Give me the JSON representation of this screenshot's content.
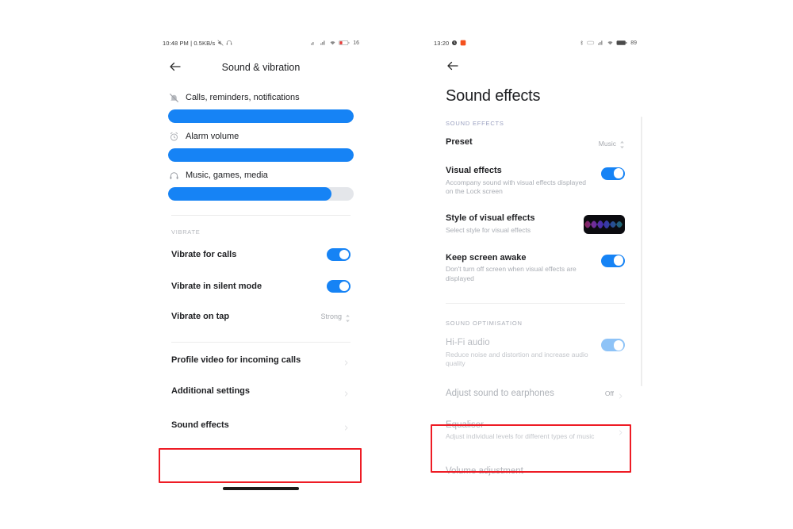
{
  "left_phone": {
    "status_bar": {
      "time": "10:48 PM | 0.5KB/s",
      "icons_left": [
        "mute-icon",
        "headphone-icon"
      ],
      "icons_right": [
        "signal-1-icon",
        "signal-2-icon",
        "wifi-icon",
        "battery-low-icon"
      ],
      "battery": "16"
    },
    "appbar": {
      "back": "back-arrow-icon",
      "title": "Sound & vibration"
    },
    "sliders": [
      {
        "icon": "ringer-muted-icon",
        "label": "Calls, reminders, notifications",
        "value": 100
      },
      {
        "icon": "alarm-clock-icon",
        "label": "Alarm volume",
        "value": 100
      },
      {
        "icon": "headphone-icon",
        "label": "Music, games, media",
        "value": 88
      }
    ],
    "vibrate_section": {
      "caption": "VIBRATE",
      "rows": [
        {
          "label": "Vibrate for calls",
          "control": "toggle",
          "on": true
        },
        {
          "label": "Vibrate in silent mode",
          "control": "toggle",
          "on": true
        },
        {
          "label": "Vibrate on tap",
          "control": "value",
          "value": "Strong"
        }
      ]
    },
    "link_rows": [
      {
        "label": "Profile video for incoming calls",
        "chevron": "chevron-right-icon"
      },
      {
        "label": "Additional settings",
        "chevron": "chevron-right-icon"
      },
      {
        "label": "Sound effects",
        "chevron": "chevron-right-icon",
        "highlighted": true
      }
    ]
  },
  "right_phone": {
    "status_bar": {
      "time": "13:20",
      "icons_left": [
        "alarm-icon",
        "app-notification-icon"
      ],
      "icons_right": [
        "bluetooth-icon",
        "nfc-icon",
        "signal-icon",
        "wifi-icon",
        "battery-icon"
      ],
      "battery": "89"
    },
    "appbar": {
      "back": "back-arrow-icon"
    },
    "page_title": "Sound effects",
    "sound_effects_section": {
      "caption": "SOUND EFFECTS",
      "rows": [
        {
          "title": "Preset",
          "value": "Music",
          "control": "stepper"
        },
        {
          "title": "Visual effects",
          "subtitle": "Accompany sound with visual effects displayed on the Lock screen",
          "control": "toggle",
          "on": true
        },
        {
          "title": "Style of visual effects",
          "subtitle": "Select style for visual effects",
          "control": "thumbnail"
        },
        {
          "title": "Keep screen awake",
          "subtitle": "Don't turn off screen when visual effects are displayed",
          "control": "toggle",
          "on": true
        }
      ]
    },
    "sound_optimisation_section": {
      "caption": "SOUND OPTIMISATION",
      "rows": [
        {
          "title": "Hi-Fi audio",
          "subtitle": "Reduce noise and distortion and increase audio quality",
          "control": "toggle",
          "on": true,
          "disabled": true
        },
        {
          "title": "Adjust sound to earphones",
          "value": "Off",
          "control": "chevron"
        },
        {
          "title": "Equaliser",
          "subtitle": "Adjust individual levels for different types of music",
          "control": "chevron",
          "highlighted": true
        },
        {
          "title": "Volume adjustment",
          "control": "none"
        }
      ]
    }
  },
  "annotations": {
    "highlight_color": "#ee1c25",
    "boxes": [
      "sound-effects-row",
      "equaliser-row"
    ]
  },
  "theme": {
    "accent": "#1683f5",
    "accent_dim": "#8ec3f7",
    "track": "#e4e6ea",
    "text": "#202124",
    "muted": "#a9adb4",
    "background": "#ffffff"
  }
}
